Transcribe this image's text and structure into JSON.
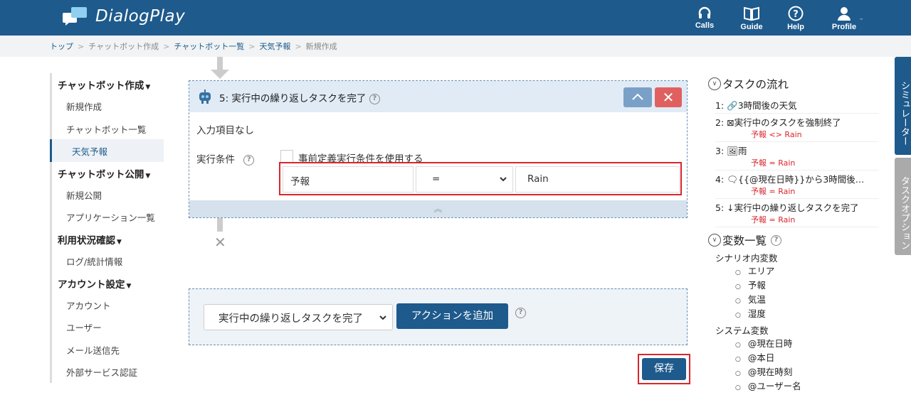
{
  "header": {
    "logo_text": "DialogPlay",
    "nav": [
      {
        "label": "Calls",
        "icon": "headset-icon"
      },
      {
        "label": "Guide",
        "icon": "book-icon"
      },
      {
        "label": "Help",
        "icon": "help-icon"
      },
      {
        "label": "Profile",
        "icon": "user-icon"
      }
    ]
  },
  "breadcrumb": [
    "トップ",
    "チャットボット作成",
    "チャットボット一覧",
    "天気予報",
    "新規作成"
  ],
  "sidebar": {
    "sections": [
      {
        "title": "チャットボット作成",
        "items": [
          "新規作成",
          "チャットボット一覧",
          "天気予報"
        ]
      },
      {
        "title": "チャットボット公開",
        "items": [
          "新規公開",
          "アプリケーション一覧"
        ]
      },
      {
        "title": "利用状況確認",
        "items": [
          "ログ/統計情報"
        ]
      },
      {
        "title": "アカウント設定",
        "items": [
          "アカウント",
          "ユーザー",
          "メール送信先",
          "外部サービス認証"
        ]
      }
    ],
    "active": "天気予報"
  },
  "task": {
    "title": "5: 実行中の繰り返しタスクを完了",
    "no_input": "入力項目なし",
    "condition_label": "実行条件",
    "predefined_label": "事前定義実行条件を使用する",
    "cond_variable": "予報",
    "cond_operator": "=",
    "cond_value": "Rain"
  },
  "action": {
    "selected": "実行中の繰り返しタスクを完了",
    "add_label": "アクションを追加"
  },
  "save_label": "保存",
  "flow": {
    "title": "タスクの流れ",
    "items": [
      {
        "num": "1:",
        "icon": "link-icon",
        "text": "3時間後の天気",
        "cond": ""
      },
      {
        "num": "2:",
        "icon": "terminate-icon",
        "text": "実行中のタスクを強制終了",
        "cond": "予報 <> Rain"
      },
      {
        "num": "3:",
        "icon": "image-icon",
        "text": "雨",
        "cond": "予報 = Rain"
      },
      {
        "num": "4:",
        "icon": "chat-icon",
        "text": "{{@現在日時}}から3時間後…",
        "cond": "予報 = Rain"
      },
      {
        "num": "5:",
        "icon": "down-arrow-icon",
        "text": "実行中の繰り返しタスクを完了",
        "cond": "予報 = Rain"
      }
    ]
  },
  "vars": {
    "title": "変数一覧",
    "scenario_title": "シナリオ内変数",
    "scenario": [
      "エリア",
      "予報",
      "気温",
      "湿度"
    ],
    "system_title": "システム変数",
    "system": [
      "@現在日時",
      "@本日",
      "@現在時刻",
      "@ユーザー名"
    ]
  },
  "tabs": {
    "simulator": "シミュレーター",
    "options": "タスクオプション"
  }
}
